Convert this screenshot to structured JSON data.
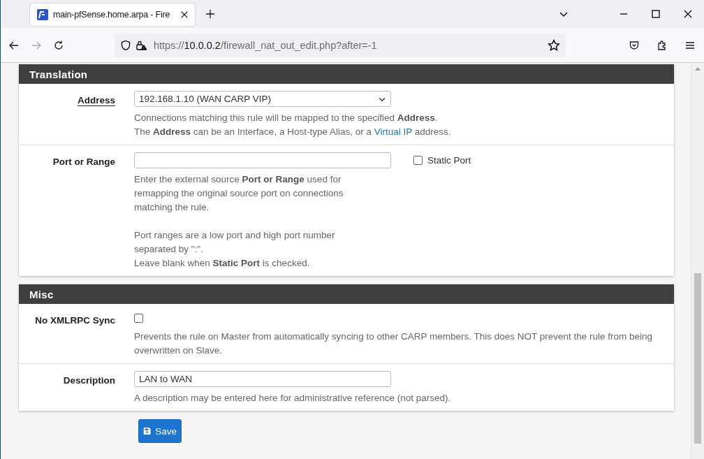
{
  "browser": {
    "tab": {
      "title": "main-pfSense.home.arpa - Fire",
      "selected": true
    },
    "url": {
      "scheme": "https://",
      "host": "10.0.0.2",
      "path": "/firewall_nat_out_edit.php?after=-1"
    },
    "forward_disabled": true
  },
  "sections": [
    {
      "title": "Translation",
      "rows": [
        {
          "label": "Address",
          "underlined": true,
          "field": {
            "kind": "select",
            "value": "192.168.1.10 (WAN CARP VIP)"
          },
          "help": [
            [
              [
                {
                  "text": "Connections matching this rule will be mapped to the specified **Address**."
                }
              ],
              [
                {
                  "text": "The **Address** can be an Interface, a Host-type Alias, or a "
                },
                {
                  "link": "Virtual IP"
                },
                {
                  "text": " address."
                }
              ]
            ]
          ]
        },
        {
          "label": "Port or Range",
          "underlined": false,
          "field": {
            "kind": "input"
          },
          "side": {
            "kind": "checkbox",
            "label": "Static Port",
            "checked": false
          },
          "help": [
            [
              [
                {
                  "text": "Enter the external source **Port or Range** used for remapping the original source port on connections matching the rule."
                }
              ]
            ],
            [
              [
                {
                  "text": "Port ranges are a low port and high port number separated by \":\"."
                }
              ],
              [
                {
                  "text": "Leave blank when **Static Port** is checked."
                }
              ]
            ]
          ]
        }
      ]
    },
    {
      "title": "Misc",
      "rows": [
        {
          "label": "No XMLRPC Sync",
          "underlined": false,
          "field": {
            "kind": "checkbox",
            "checked": false
          },
          "help": [
            [
              [
                {
                  "text": "Prevents the rule on Master from automatically syncing to other CARP members. This does NOT prevent the rule from being overwritten on Slave."
                }
              ]
            ]
          ]
        },
        {
          "label": "Description",
          "underlined": false,
          "field": {
            "kind": "input",
            "value": "LAN to WAN"
          },
          "help": [
            [
              [
                {
                  "text": "A description may be entered here for administrative reference (not parsed)."
                }
              ]
            ]
          ]
        }
      ]
    }
  ],
  "save_button": {
    "label": "Save"
  }
}
